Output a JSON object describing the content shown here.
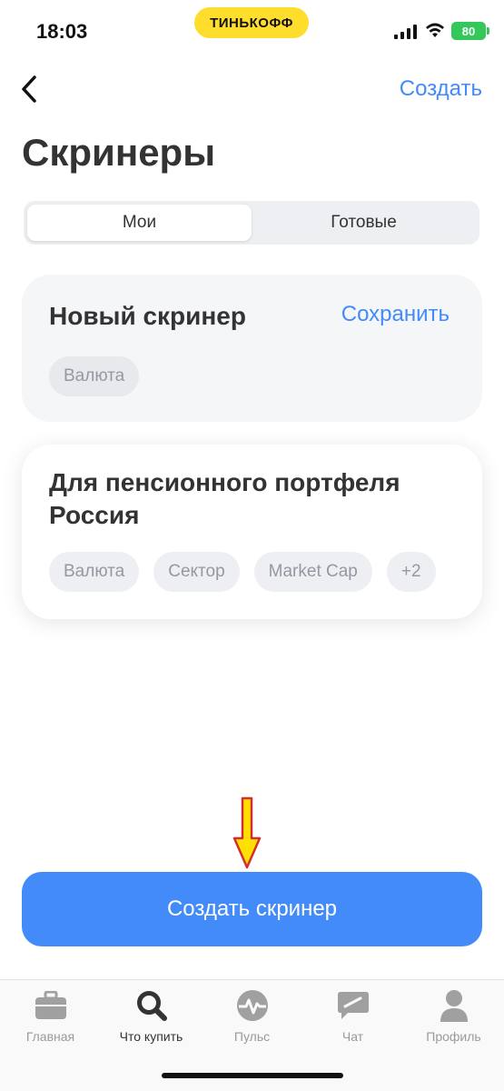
{
  "status_bar": {
    "time": "18:03",
    "brand": "ТИНЬКОФФ",
    "battery": "80"
  },
  "nav": {
    "back_icon": "chevron-left-icon",
    "create_label": "Создать"
  },
  "page": {
    "title": "Скринеры"
  },
  "segmented": {
    "tabs": [
      {
        "label": "Мои",
        "active": true
      },
      {
        "label": "Готовые",
        "active": false
      }
    ]
  },
  "screeners": [
    {
      "title": "Новый скринер",
      "action_label": "Сохранить",
      "chips": [
        "Валюта"
      ]
    },
    {
      "title": "Для пенсионного портфеля Россия",
      "chips": [
        "Валюта",
        "Сектор",
        "Market Cap",
        "+2"
      ]
    }
  ],
  "primary_button": {
    "label": "Создать скринер"
  },
  "tab_bar": {
    "items": [
      {
        "label": "Главная",
        "icon": "briefcase-icon",
        "active": false
      },
      {
        "label": "Что купить",
        "icon": "search-icon",
        "active": true
      },
      {
        "label": "Пульс",
        "icon": "pulse-icon",
        "active": false
      },
      {
        "label": "Чат",
        "icon": "chat-icon",
        "active": false
      },
      {
        "label": "Профиль",
        "icon": "profile-icon",
        "active": false
      }
    ]
  },
  "colors": {
    "accent": "#428BF9",
    "brand_yellow": "#FFDD2D",
    "battery_green": "#34C759",
    "annotation_arrow": "#FFE000"
  }
}
